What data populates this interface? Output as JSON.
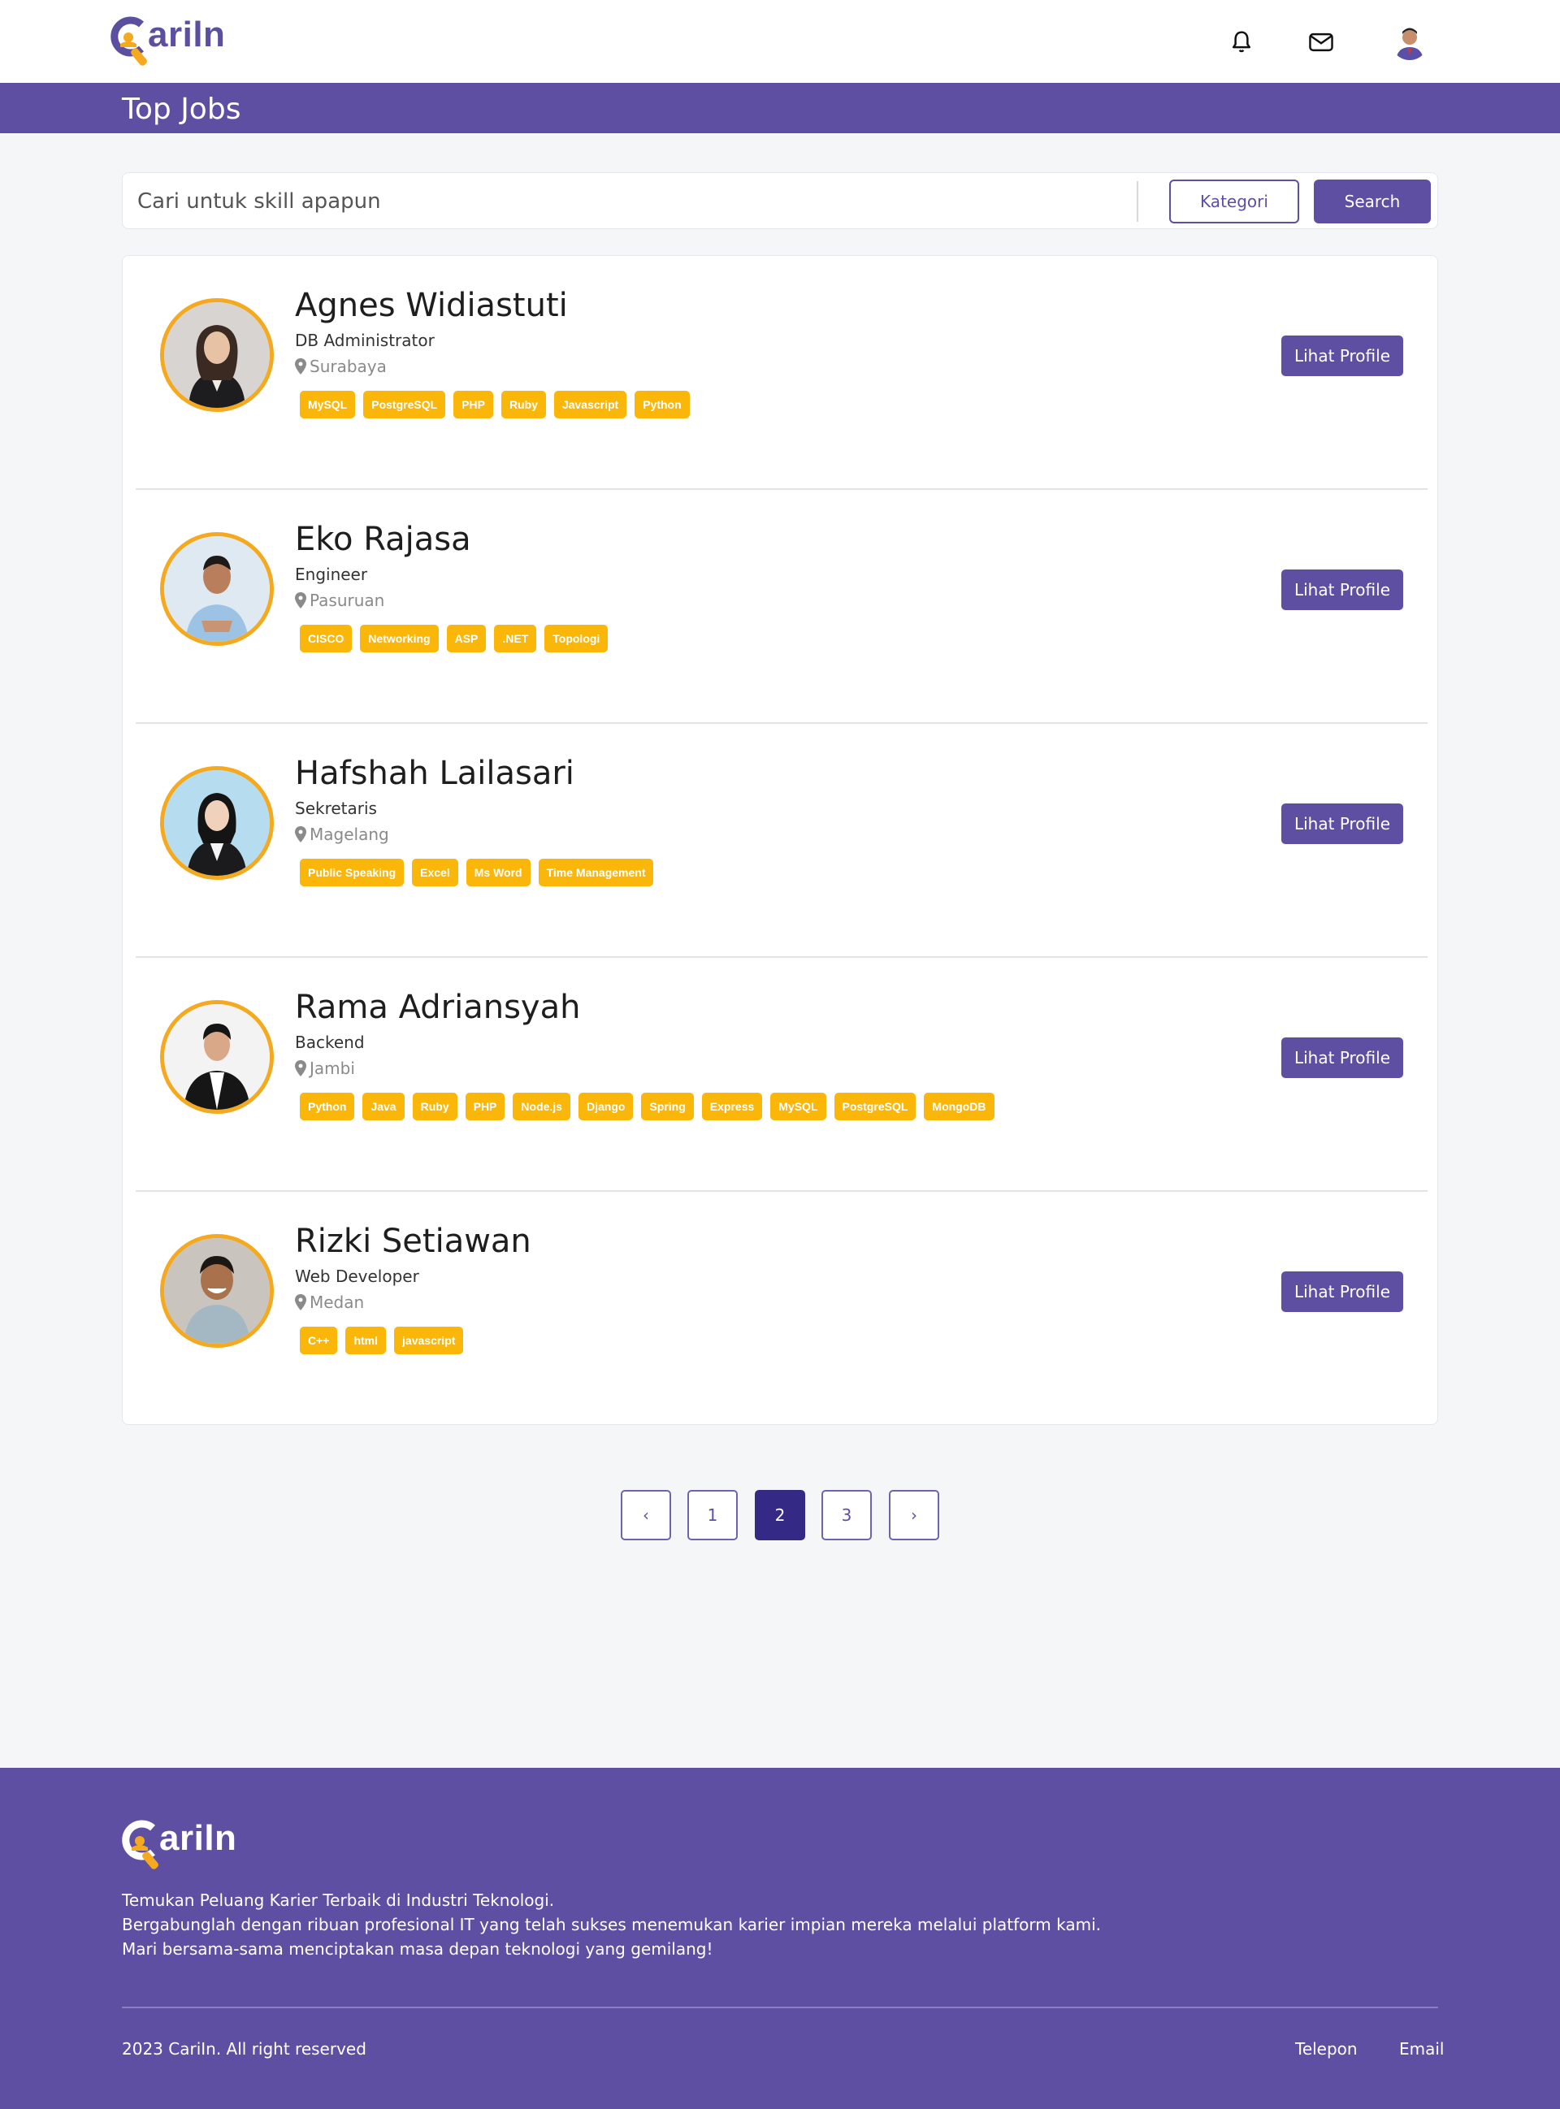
{
  "brand": {
    "name": "ariln",
    "logo_letter": "C"
  },
  "navbar": {
    "icons": [
      "bell-icon",
      "mail-icon",
      "user-avatar"
    ]
  },
  "header": {
    "title": "Top Jobs"
  },
  "search": {
    "placeholder": "Cari untuk skill apapun",
    "value": "",
    "category_label": "Kategori",
    "search_label": "Search"
  },
  "profiles": [
    {
      "name": "Agnes Widiastuti",
      "role": "DB Administrator",
      "location": "Surabaya",
      "skills": [
        "MySQL",
        "PostgreSQL",
        "PHP",
        "Ruby",
        "Javascript",
        "Python"
      ],
      "button": "Lihat Profile"
    },
    {
      "name": "Eko Rajasa",
      "role": "Engineer",
      "location": "Pasuruan",
      "skills": [
        "CISCO",
        "Networking",
        "ASP",
        ".NET",
        "Topologi"
      ],
      "button": "Lihat Profile"
    },
    {
      "name": "Hafshah Lailasari",
      "role": "Sekretaris",
      "location": "Magelang",
      "skills": [
        "Public Speaking",
        "Excel",
        "Ms Word",
        "Time Management"
      ],
      "button": "Lihat Profile"
    },
    {
      "name": "Rama Adriansyah",
      "role": "Backend",
      "location": "Jambi",
      "skills": [
        "Python",
        "Java",
        "Ruby",
        "PHP",
        "Node.js",
        "Django",
        "Spring",
        "Express",
        "MySQL",
        "PostgreSQL",
        "MongoDB"
      ],
      "button": "Lihat Profile"
    },
    {
      "name": "Rizki Setiawan",
      "role": "Web Developer",
      "location": "Medan",
      "skills": [
        "C++",
        "html",
        "javascript"
      ],
      "button": "Lihat Profile"
    }
  ],
  "pagination": {
    "pages": [
      "1",
      "2",
      "3"
    ],
    "current": "2",
    "prev": "‹",
    "next": "›"
  },
  "footer": {
    "lines": [
      "Temukan Peluang Karier Terbaik di Industri Teknologi.",
      "Bergabunglah dengan ribuan profesional IT yang telah sukses menemukan karier impian mereka melalui platform kami.",
      "Mari bersama-sama menciptakan masa depan teknologi yang gemilang!"
    ],
    "copyright": "2023 CariIn. All right reserved",
    "links": [
      "Telepon",
      "Email"
    ]
  },
  "colors": {
    "primary": "#5e4fa2",
    "accent": "#f4a91f",
    "tag": "#fbb709",
    "active_page": "#342a86"
  }
}
